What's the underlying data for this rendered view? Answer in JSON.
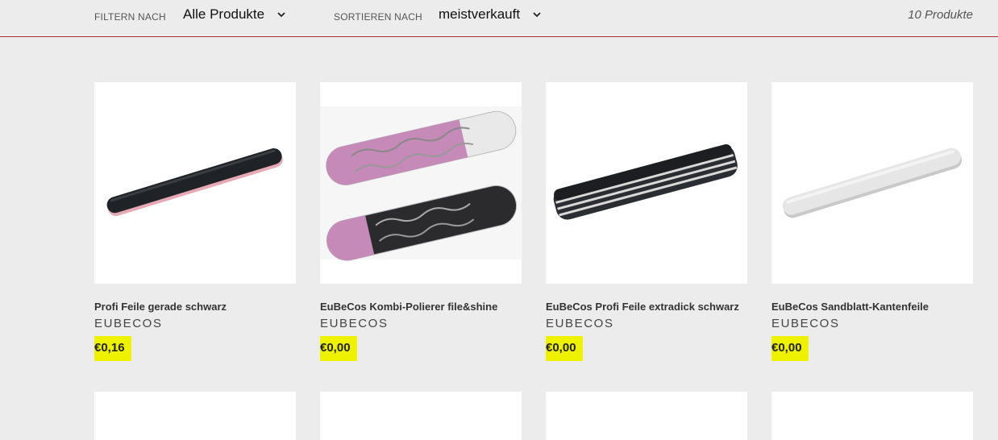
{
  "toolbar": {
    "filter_label": "FILTERN NACH",
    "filter_value": "Alle Produkte",
    "sort_label": "SORTIEREN NACH",
    "sort_value": "meistverkauft",
    "count": "10 Produkte"
  },
  "colors": {
    "background": "#ececec",
    "divider": "#b0303a",
    "price_highlight": "#eef200"
  },
  "products": [
    {
      "title": "Profi Feile gerade schwarz",
      "vendor": "EUBECOS",
      "price": "€0,16",
      "image": "black-nail-file"
    },
    {
      "title": "EuBeCos Kombi-Polierer file&shine",
      "vendor": "EUBECOS",
      "price": "€0,00",
      "image": "floral-pink-polishers"
    },
    {
      "title": "EuBeCos Profi Feile extradick schwarz",
      "vendor": "EUBECOS",
      "price": "€0,00",
      "image": "thick-black-file"
    },
    {
      "title": "EuBeCos Sandblatt-Kantenfeile",
      "vendor": "EUBECOS",
      "price": "€0,00",
      "image": "white-sand-file"
    }
  ]
}
